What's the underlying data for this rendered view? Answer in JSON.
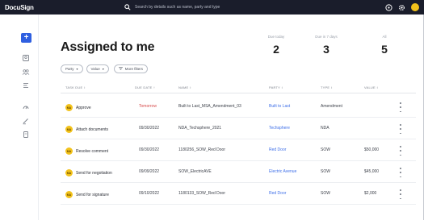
{
  "app": {
    "logo": "DocuSign",
    "search_placeholder": "Search by details such as name, party and type"
  },
  "page": {
    "title": "Assigned to me"
  },
  "stats": [
    {
      "label": "Due today",
      "value": "2"
    },
    {
      "label": "Due in 7 days",
      "value": "3"
    },
    {
      "label": "All",
      "value": "5"
    }
  ],
  "filters": [
    {
      "label": "Party"
    },
    {
      "label": "Value"
    }
  ],
  "more_filters_label": "More filters",
  "table": {
    "columns": [
      "Task due",
      "Due date",
      "Name",
      "Party",
      "Type",
      "Value"
    ],
    "rows": [
      {
        "initials": "MA",
        "task": "Approve",
        "due": "Tomorrow",
        "name": "Built to Last_MSA_Amendment_03",
        "party": "Built to Last",
        "type": "Amendment",
        "value": ""
      },
      {
        "initials": "MA",
        "task": "Attach documents",
        "due": "09/30/2022",
        "name": "NDA_Techsphere_2021",
        "party": "Techsphere",
        "type": "NDA",
        "value": ""
      },
      {
        "initials": "MA",
        "task": "Resolve comment",
        "due": "09/30/2022",
        "name": "1180256_SOW_Red Door",
        "party": "Red Door",
        "type": "SOW",
        "value": "$50,000"
      },
      {
        "initials": "MA",
        "task": "Send for negotiation",
        "due": "09/09/2022",
        "name": "SOW_ElectricAVE",
        "party": "Electric Avenue",
        "type": "SOW",
        "value": "$45,000"
      },
      {
        "initials": "MA",
        "task": "Send for signature",
        "due": "09/10/2022",
        "name": "1180133_SOW_Red Door",
        "party": "Red Door",
        "type": "SOW",
        "value": "$2,000"
      }
    ]
  },
  "colors": {
    "topbar": "#1a1d2b",
    "accent": "#2f5fe0",
    "avatar": "#f2c21b",
    "link": "#3d6ee8",
    "overdue": "#d64848"
  },
  "icons": {
    "topbar": [
      "help-icon",
      "settings-icon",
      "user-avatar"
    ],
    "rail": [
      "new-icon",
      "person-icon",
      "group-icon",
      "list-icon",
      "scale-icon",
      "pen-icon",
      "document-icon"
    ]
  }
}
